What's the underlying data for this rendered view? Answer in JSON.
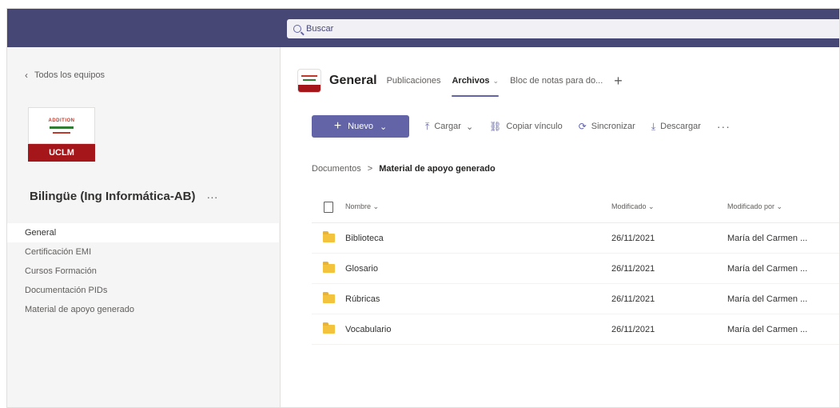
{
  "search": {
    "placeholder": "Buscar"
  },
  "sidebar": {
    "back_label": "Todos los equipos",
    "logo": {
      "top_text": "ADDITION",
      "bottom_text": "UCLM"
    },
    "team_name": "Bilingüe (Ing Informática-AB)",
    "more": "···",
    "channels": [
      {
        "label": "General",
        "active": true
      },
      {
        "label": "Certificación EMI",
        "active": false
      },
      {
        "label": "Cursos Formación",
        "active": false
      },
      {
        "label": "Documentación PIDs",
        "active": false
      },
      {
        "label": "Material de apoyo generado",
        "active": false
      }
    ]
  },
  "channel": {
    "title": "General",
    "tabs": [
      {
        "label": "Publicaciones"
      },
      {
        "label": "Archivos"
      },
      {
        "label": "Bloc de notas para do..."
      }
    ],
    "add_tab": "+"
  },
  "toolbar": {
    "new_label": "Nuevo",
    "upload_label": "Cargar",
    "copy_link_label": "Copiar vínculo",
    "sync_label": "Sincronizar",
    "download_label": "Descargar",
    "more": "···"
  },
  "breadcrumb": {
    "root": "Documentos",
    "separator": ">",
    "current": "Material de apoyo generado"
  },
  "table": {
    "headers": {
      "name": "Nombre",
      "modified": "Modificado",
      "modified_by": "Modificado por"
    },
    "rows": [
      {
        "name": "Biblioteca",
        "modified": "26/11/2021",
        "modified_by": "María del Carmen ..."
      },
      {
        "name": "Glosario",
        "modified": "26/11/2021",
        "modified_by": "María del Carmen ..."
      },
      {
        "name": "Rúbricas",
        "modified": "26/11/2021",
        "modified_by": "María del Carmen ..."
      },
      {
        "name": "Vocabulario",
        "modified": "26/11/2021",
        "modified_by": "María del Carmen ..."
      }
    ]
  },
  "colors": {
    "accent": "#6264a7",
    "topbar": "#464775",
    "folder": "#f4c33d"
  }
}
